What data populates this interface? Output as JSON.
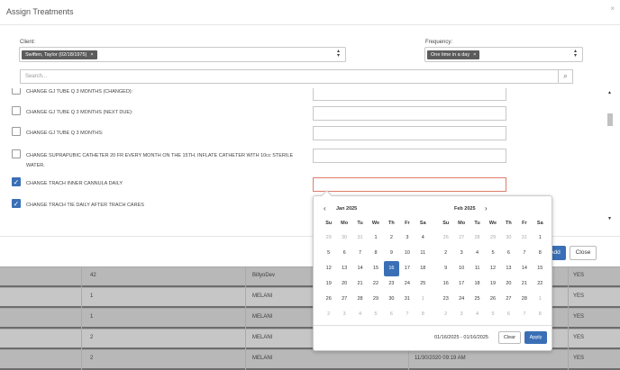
{
  "dialog": {
    "title": "Assign Treatments",
    "close_icon": "×",
    "client_label": "Client:",
    "client_tag": "Swiften, Taylor (02/18/1975)",
    "tag_remove": "×",
    "frequency_label": "Frequency:",
    "frequency_tag": "One time in a day",
    "search_placeholder": "Search...",
    "add_label": "Add",
    "close_label": "Close"
  },
  "treatments": [
    {
      "label": "CHANGE GJ TUBE Q 3 MONTHS (CHANGED):",
      "checked": false
    },
    {
      "label": "CHANGE GJ TUBE Q 3 MONTHS (NEXT DUE):",
      "checked": false
    },
    {
      "label": "CHANGE GJ TUBE Q 3 MONTHS:",
      "checked": false
    },
    {
      "label": "CHANGE SUPRAPUBIC CATHETER 20 FR EVERY MONTH ON THE 15TH. INFLATE CATHETER WITH 10cc STERILE WATER.",
      "checked": false
    },
    {
      "label": "CHANGE TRACH INNER CANNULA DAILY",
      "checked": true
    },
    {
      "label": "CHANGE TRACH TIE DAILY AFTER TRACH CARES",
      "checked": true
    }
  ],
  "check_glyph": "✓",
  "picker": {
    "left_month": "Jan 2025",
    "right_month": "Feb 2025",
    "weekdays": [
      "Su",
      "Mo",
      "Tu",
      "We",
      "Th",
      "Fr",
      "Sa"
    ],
    "left_days": [
      [
        "29",
        "off"
      ],
      [
        "30",
        "off"
      ],
      [
        "31",
        "off"
      ],
      [
        "1",
        ""
      ],
      [
        "2",
        ""
      ],
      [
        "3",
        ""
      ],
      [
        "4",
        ""
      ],
      [
        "5",
        ""
      ],
      [
        "6",
        ""
      ],
      [
        "7",
        ""
      ],
      [
        "8",
        ""
      ],
      [
        "9",
        ""
      ],
      [
        "10",
        ""
      ],
      [
        "11",
        ""
      ],
      [
        "12",
        ""
      ],
      [
        "13",
        ""
      ],
      [
        "14",
        ""
      ],
      [
        "15",
        ""
      ],
      [
        "16",
        "sel"
      ],
      [
        "17",
        ""
      ],
      [
        "18",
        ""
      ],
      [
        "19",
        ""
      ],
      [
        "20",
        ""
      ],
      [
        "21",
        ""
      ],
      [
        "22",
        ""
      ],
      [
        "23",
        ""
      ],
      [
        "24",
        ""
      ],
      [
        "25",
        ""
      ],
      [
        "26",
        ""
      ],
      [
        "27",
        ""
      ],
      [
        "28",
        ""
      ],
      [
        "29",
        ""
      ],
      [
        "30",
        ""
      ],
      [
        "31",
        ""
      ],
      [
        "1",
        "off"
      ],
      [
        "2",
        "off"
      ],
      [
        "3",
        "off"
      ],
      [
        "4",
        "off"
      ],
      [
        "5",
        "off"
      ],
      [
        "6",
        "off"
      ],
      [
        "7",
        "off"
      ],
      [
        "8",
        "off"
      ]
    ],
    "right_days": [
      [
        "26",
        "off"
      ],
      [
        "27",
        "off"
      ],
      [
        "28",
        "off"
      ],
      [
        "29",
        "off"
      ],
      [
        "30",
        "off"
      ],
      [
        "31",
        "off"
      ],
      [
        "1",
        ""
      ],
      [
        "2",
        ""
      ],
      [
        "3",
        ""
      ],
      [
        "4",
        ""
      ],
      [
        "5",
        ""
      ],
      [
        "6",
        ""
      ],
      [
        "7",
        ""
      ],
      [
        "8",
        ""
      ],
      [
        "9",
        ""
      ],
      [
        "10",
        ""
      ],
      [
        "11",
        ""
      ],
      [
        "12",
        ""
      ],
      [
        "13",
        ""
      ],
      [
        "14",
        ""
      ],
      [
        "15",
        ""
      ],
      [
        "16",
        ""
      ],
      [
        "17",
        ""
      ],
      [
        "18",
        ""
      ],
      [
        "19",
        ""
      ],
      [
        "20",
        ""
      ],
      [
        "21",
        ""
      ],
      [
        "22",
        ""
      ],
      [
        "23",
        ""
      ],
      [
        "24",
        ""
      ],
      [
        "25",
        ""
      ],
      [
        "26",
        ""
      ],
      [
        "27",
        ""
      ],
      [
        "28",
        ""
      ],
      [
        "1",
        "off"
      ],
      [
        "2",
        "off"
      ],
      [
        "3",
        "off"
      ],
      [
        "4",
        "off"
      ],
      [
        "5",
        "off"
      ],
      [
        "6",
        "off"
      ],
      [
        "7",
        "off"
      ],
      [
        "8",
        "off"
      ]
    ],
    "range_text": "01/16/2025 - 01/16/2025",
    "clear_label": "Clear",
    "apply_label": "Apply"
  },
  "background_table": {
    "rows": [
      [
        "42",
        "BillyoDev",
        "",
        "YES"
      ],
      [
        "1",
        "MELANI",
        "",
        "YES"
      ],
      [
        "1",
        "MELANI",
        "",
        "YES"
      ],
      [
        "2",
        "MELANI",
        "",
        "YES"
      ],
      [
        "2",
        "MELANI",
        "11/30/2020 09:19 AM",
        "YES"
      ]
    ]
  },
  "colors": {
    "accent": "#3a6fb6",
    "tag": "#5c5c5c",
    "active_border": "#e07c6a"
  }
}
